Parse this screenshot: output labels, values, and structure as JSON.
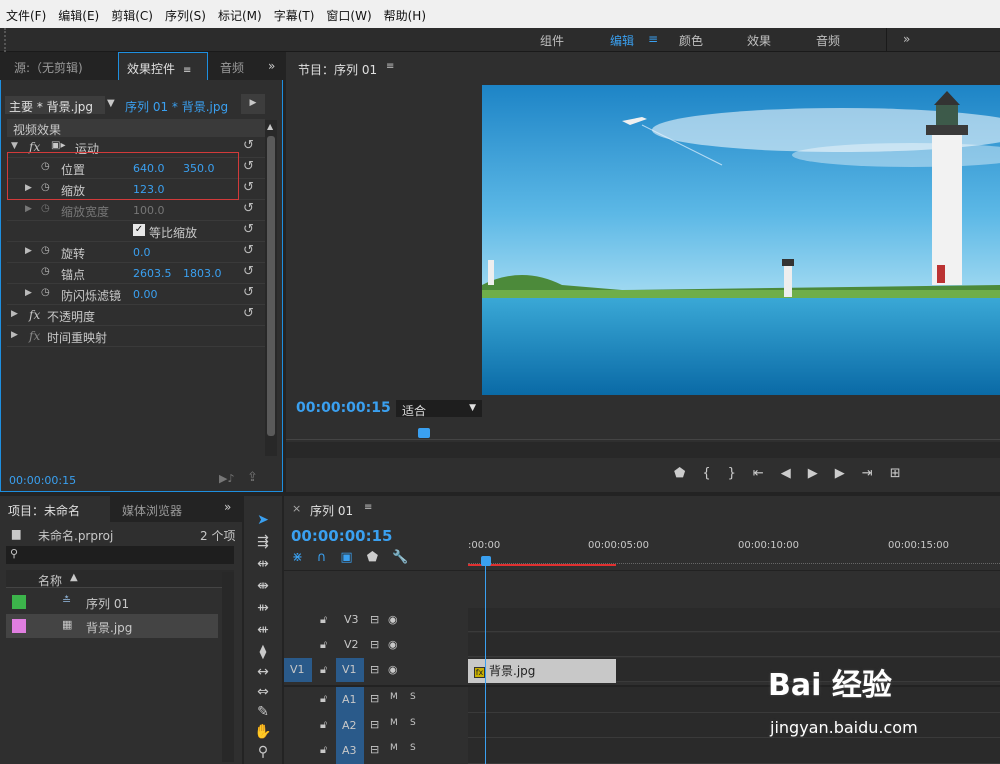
{
  "menu": [
    "文件(F)",
    "编辑(E)",
    "剪辑(C)",
    "序列(S)",
    "标记(M)",
    "字幕(T)",
    "窗口(W)",
    "帮助(H)"
  ],
  "workspaces": [
    "组件",
    "编辑",
    "颜色",
    "效果",
    "音频"
  ],
  "workspace_more": "»",
  "source_panel": {
    "tabs": [
      "源:（无剪辑)",
      "效果控件",
      "音频"
    ],
    "more": "»",
    "master_label": "主要 * 背景.jpg",
    "sequence_label": "序列 01 * 背景.jpg",
    "section": "视频效果",
    "rows": {
      "motion": "运动",
      "position": "位置",
      "position_x": "640.0",
      "position_y": "350.0",
      "scale": "缩放",
      "scale_v": "123.0",
      "scale_width": "缩放宽度",
      "scale_width_v": "100.0",
      "uniform": "等比缩放",
      "rotation": "旋转",
      "rotation_v": "0.0",
      "anchor": "锚点",
      "anchor_x": "2603.5",
      "anchor_y": "1803.0",
      "flicker": "防闪烁滤镜",
      "flicker_v": "0.00",
      "opacity": "不透明度",
      "time_remap": "时间重映射"
    },
    "timecode": "00:00:00:15"
  },
  "program": {
    "title": "节目：序列 01",
    "timecode": "00:00:00:15",
    "fit": "适合"
  },
  "project": {
    "tabs": [
      "项目：未命名",
      "媒体浏览器"
    ],
    "more": "»",
    "file": "未命名.prproj",
    "count": "2 个项",
    "col_name": "名称",
    "items": [
      {
        "name": "序列 01",
        "color": "#3cb44b"
      },
      {
        "name": "背景.jpg",
        "color": "#e07ee0"
      }
    ]
  },
  "timeline": {
    "tab": "序列 01",
    "timecode": "00:00:00:15",
    "ruler": [
      ":00:00",
      "00:00:05:00",
      "00:00:10:00",
      "00:00:15:00"
    ],
    "video_tracks": [
      "V3",
      "V2",
      "V1"
    ],
    "audio_tracks": [
      "A1",
      "A2",
      "A3"
    ],
    "src_patch": "V1",
    "clip": "背景.jpg",
    "m": "M",
    "s": "S"
  },
  "watermark": {
    "brand": "Bai 经验",
    "url": "jingyan.baidu.com"
  }
}
